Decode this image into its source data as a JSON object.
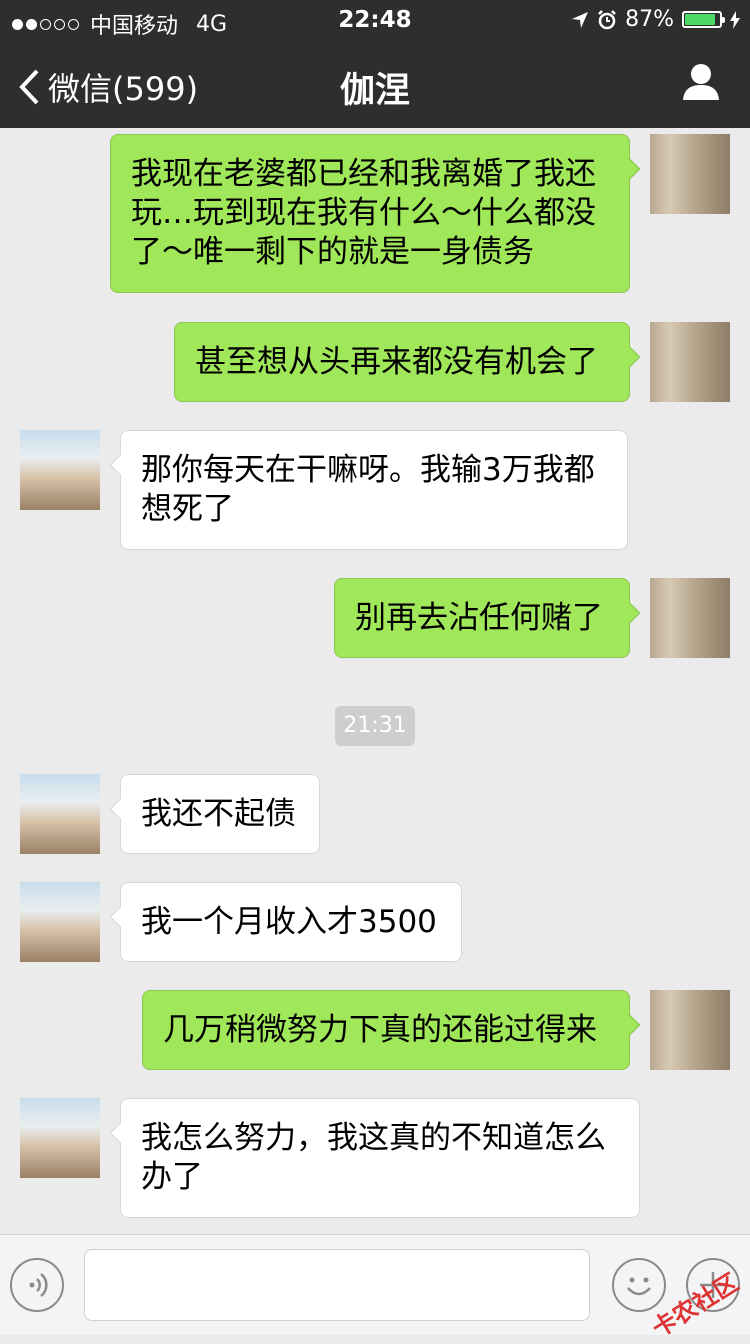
{
  "status_bar": {
    "carrier": "中国移动",
    "network": "4G",
    "time": "22:48",
    "battery_percent": "87%",
    "battery_level": 0.87,
    "icons": [
      "signal-dots-icon",
      "location-arrow-icon",
      "alarm-clock-icon",
      "battery-icon",
      "charging-bolt-icon"
    ]
  },
  "nav": {
    "back_label": "微信(599)",
    "title": "伽涅",
    "profile_icon": "person-icon"
  },
  "messages": [
    {
      "from": "me",
      "text": "我现在老婆都已经和我离婚了我还玩…玩到现在我有什么～什么都没了～唯一剩下的就是一身债务"
    },
    {
      "from": "me",
      "text": "甚至想从头再来都没有机会了"
    },
    {
      "from": "them",
      "text": "那你每天在干嘛呀。我输3万我都想死了"
    },
    {
      "from": "me",
      "text": "别再去沾任何赌了"
    },
    {
      "from": "them",
      "text": "我还不起债"
    },
    {
      "from": "them",
      "text": "我一个月收入才3500"
    },
    {
      "from": "me",
      "text": "几万稍微努力下真的还能过得来"
    },
    {
      "from": "them",
      "text": "我怎么努力，我这真的不知道怎么办了"
    }
  ],
  "timestamp": "21:31",
  "input_bar": {
    "voice_icon": "voice-icon",
    "emoji_icon": "emoji-icon",
    "plus_icon": "plus-icon",
    "input_value": ""
  },
  "watermark": "卡农社区",
  "colors": {
    "nav_bg": "#2e2e2e",
    "bubble_me": "#a0e75a",
    "bubble_them": "#ffffff",
    "chat_bg": "#ebebeb"
  }
}
